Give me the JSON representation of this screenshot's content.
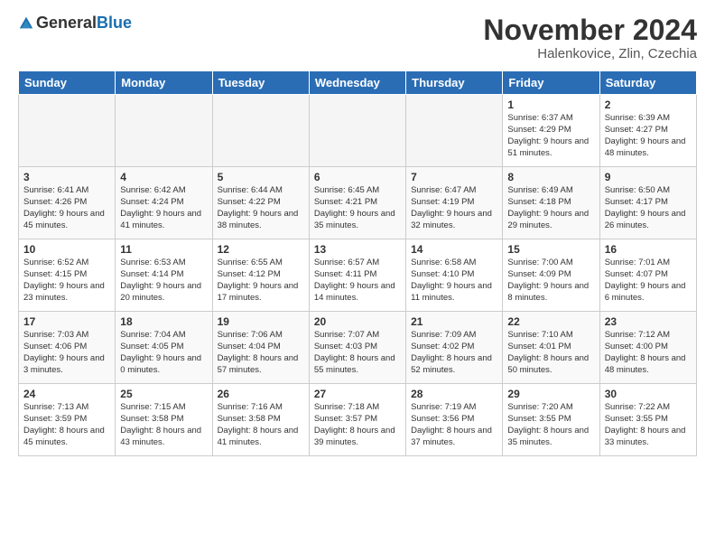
{
  "header": {
    "logo_general": "General",
    "logo_blue": "Blue",
    "month_title": "November 2024",
    "location": "Halenkovice, Zlin, Czechia"
  },
  "days_of_week": [
    "Sunday",
    "Monday",
    "Tuesday",
    "Wednesday",
    "Thursday",
    "Friday",
    "Saturday"
  ],
  "weeks": [
    [
      {
        "day": "",
        "info": ""
      },
      {
        "day": "",
        "info": ""
      },
      {
        "day": "",
        "info": ""
      },
      {
        "day": "",
        "info": ""
      },
      {
        "day": "",
        "info": ""
      },
      {
        "day": "1",
        "info": "Sunrise: 6:37 AM\nSunset: 4:29 PM\nDaylight: 9 hours\nand 51 minutes."
      },
      {
        "day": "2",
        "info": "Sunrise: 6:39 AM\nSunset: 4:27 PM\nDaylight: 9 hours\nand 48 minutes."
      }
    ],
    [
      {
        "day": "3",
        "info": "Sunrise: 6:41 AM\nSunset: 4:26 PM\nDaylight: 9 hours\nand 45 minutes."
      },
      {
        "day": "4",
        "info": "Sunrise: 6:42 AM\nSunset: 4:24 PM\nDaylight: 9 hours\nand 41 minutes."
      },
      {
        "day": "5",
        "info": "Sunrise: 6:44 AM\nSunset: 4:22 PM\nDaylight: 9 hours\nand 38 minutes."
      },
      {
        "day": "6",
        "info": "Sunrise: 6:45 AM\nSunset: 4:21 PM\nDaylight: 9 hours\nand 35 minutes."
      },
      {
        "day": "7",
        "info": "Sunrise: 6:47 AM\nSunset: 4:19 PM\nDaylight: 9 hours\nand 32 minutes."
      },
      {
        "day": "8",
        "info": "Sunrise: 6:49 AM\nSunset: 4:18 PM\nDaylight: 9 hours\nand 29 minutes."
      },
      {
        "day": "9",
        "info": "Sunrise: 6:50 AM\nSunset: 4:17 PM\nDaylight: 9 hours\nand 26 minutes."
      }
    ],
    [
      {
        "day": "10",
        "info": "Sunrise: 6:52 AM\nSunset: 4:15 PM\nDaylight: 9 hours\nand 23 minutes."
      },
      {
        "day": "11",
        "info": "Sunrise: 6:53 AM\nSunset: 4:14 PM\nDaylight: 9 hours\nand 20 minutes."
      },
      {
        "day": "12",
        "info": "Sunrise: 6:55 AM\nSunset: 4:12 PM\nDaylight: 9 hours\nand 17 minutes."
      },
      {
        "day": "13",
        "info": "Sunrise: 6:57 AM\nSunset: 4:11 PM\nDaylight: 9 hours\nand 14 minutes."
      },
      {
        "day": "14",
        "info": "Sunrise: 6:58 AM\nSunset: 4:10 PM\nDaylight: 9 hours\nand 11 minutes."
      },
      {
        "day": "15",
        "info": "Sunrise: 7:00 AM\nSunset: 4:09 PM\nDaylight: 9 hours\nand 8 minutes."
      },
      {
        "day": "16",
        "info": "Sunrise: 7:01 AM\nSunset: 4:07 PM\nDaylight: 9 hours\nand 6 minutes."
      }
    ],
    [
      {
        "day": "17",
        "info": "Sunrise: 7:03 AM\nSunset: 4:06 PM\nDaylight: 9 hours\nand 3 minutes."
      },
      {
        "day": "18",
        "info": "Sunrise: 7:04 AM\nSunset: 4:05 PM\nDaylight: 9 hours\nand 0 minutes."
      },
      {
        "day": "19",
        "info": "Sunrise: 7:06 AM\nSunset: 4:04 PM\nDaylight: 8 hours\nand 57 minutes."
      },
      {
        "day": "20",
        "info": "Sunrise: 7:07 AM\nSunset: 4:03 PM\nDaylight: 8 hours\nand 55 minutes."
      },
      {
        "day": "21",
        "info": "Sunrise: 7:09 AM\nSunset: 4:02 PM\nDaylight: 8 hours\nand 52 minutes."
      },
      {
        "day": "22",
        "info": "Sunrise: 7:10 AM\nSunset: 4:01 PM\nDaylight: 8 hours\nand 50 minutes."
      },
      {
        "day": "23",
        "info": "Sunrise: 7:12 AM\nSunset: 4:00 PM\nDaylight: 8 hours\nand 48 minutes."
      }
    ],
    [
      {
        "day": "24",
        "info": "Sunrise: 7:13 AM\nSunset: 3:59 PM\nDaylight: 8 hours\nand 45 minutes."
      },
      {
        "day": "25",
        "info": "Sunrise: 7:15 AM\nSunset: 3:58 PM\nDaylight: 8 hours\nand 43 minutes."
      },
      {
        "day": "26",
        "info": "Sunrise: 7:16 AM\nSunset: 3:58 PM\nDaylight: 8 hours\nand 41 minutes."
      },
      {
        "day": "27",
        "info": "Sunrise: 7:18 AM\nSunset: 3:57 PM\nDaylight: 8 hours\nand 39 minutes."
      },
      {
        "day": "28",
        "info": "Sunrise: 7:19 AM\nSunset: 3:56 PM\nDaylight: 8 hours\nand 37 minutes."
      },
      {
        "day": "29",
        "info": "Sunrise: 7:20 AM\nSunset: 3:55 PM\nDaylight: 8 hours\nand 35 minutes."
      },
      {
        "day": "30",
        "info": "Sunrise: 7:22 AM\nSunset: 3:55 PM\nDaylight: 8 hours\nand 33 minutes."
      }
    ]
  ]
}
